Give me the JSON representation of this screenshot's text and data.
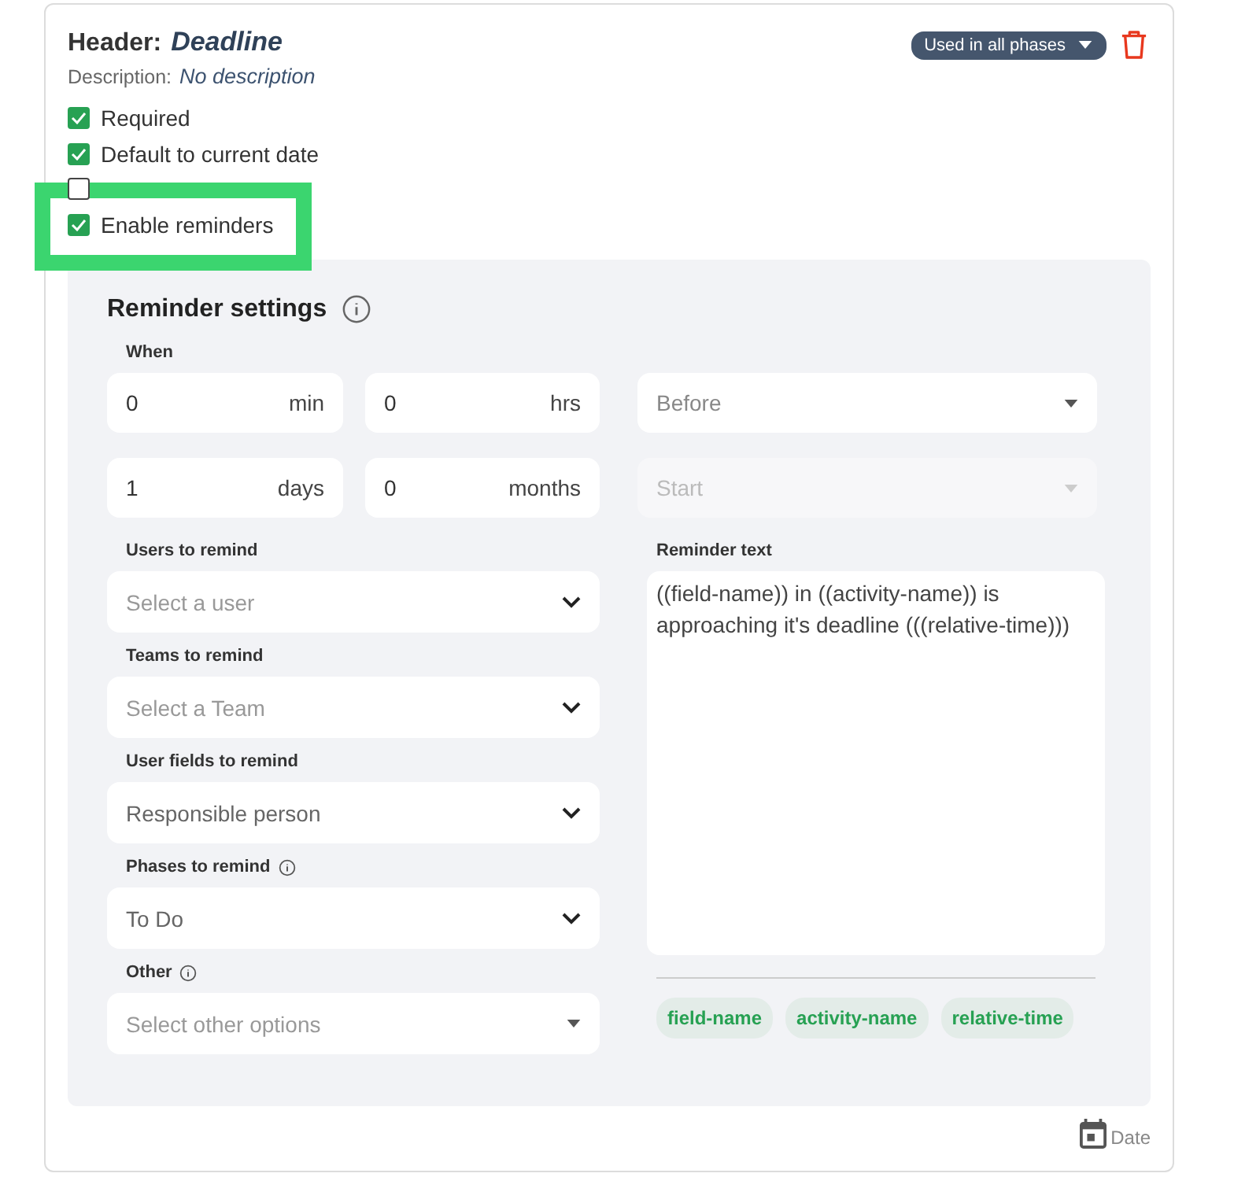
{
  "header": {
    "label": "Header:",
    "name": "Deadline",
    "description_label": "Description:",
    "description": "No description",
    "phases_button": "Used in all phases"
  },
  "options": [
    {
      "label": "Required",
      "checked": true,
      "highlighted": false
    },
    {
      "label": "Default to current date",
      "checked": true,
      "highlighted": false
    },
    {
      "checked": false,
      "highlighted": false
    },
    {
      "label": "Enable reminders",
      "checked": true,
      "highlighted": true
    }
  ],
  "reminder_settings": {
    "title": "Reminder settings",
    "when_label": "When",
    "duration": [
      {
        "value": "0",
        "unit": "min"
      },
      {
        "value": "0",
        "unit": "hrs"
      },
      {
        "value": "1",
        "unit": "days"
      },
      {
        "value": "0",
        "unit": "months"
      }
    ],
    "relation": {
      "value": "Before",
      "disabled": false
    },
    "anchor": {
      "value": "Start",
      "disabled": true
    },
    "selects": [
      {
        "label": "Users to remind",
        "placeholder": "Select a user",
        "info": false,
        "kind": "chevron"
      },
      {
        "label": "Teams to remind",
        "placeholder": "Select a Team",
        "info": false,
        "kind": "chevron"
      },
      {
        "label": "User fields to remind",
        "value": "Responsible person",
        "info": false,
        "kind": "chevron"
      },
      {
        "label": "Phases to remind",
        "value": "To Do",
        "info": true,
        "kind": "chevron"
      },
      {
        "label": "Other",
        "placeholder": "Select other options",
        "info": true,
        "kind": "caret"
      }
    ],
    "reminder_text_label": "Reminder text",
    "reminder_text": "((field-name)) in ((activity-name)) is approaching it's deadline (((relative-time)))",
    "variables": [
      "field-name",
      "activity-name",
      "relative-time"
    ]
  },
  "field_type": "Date"
}
